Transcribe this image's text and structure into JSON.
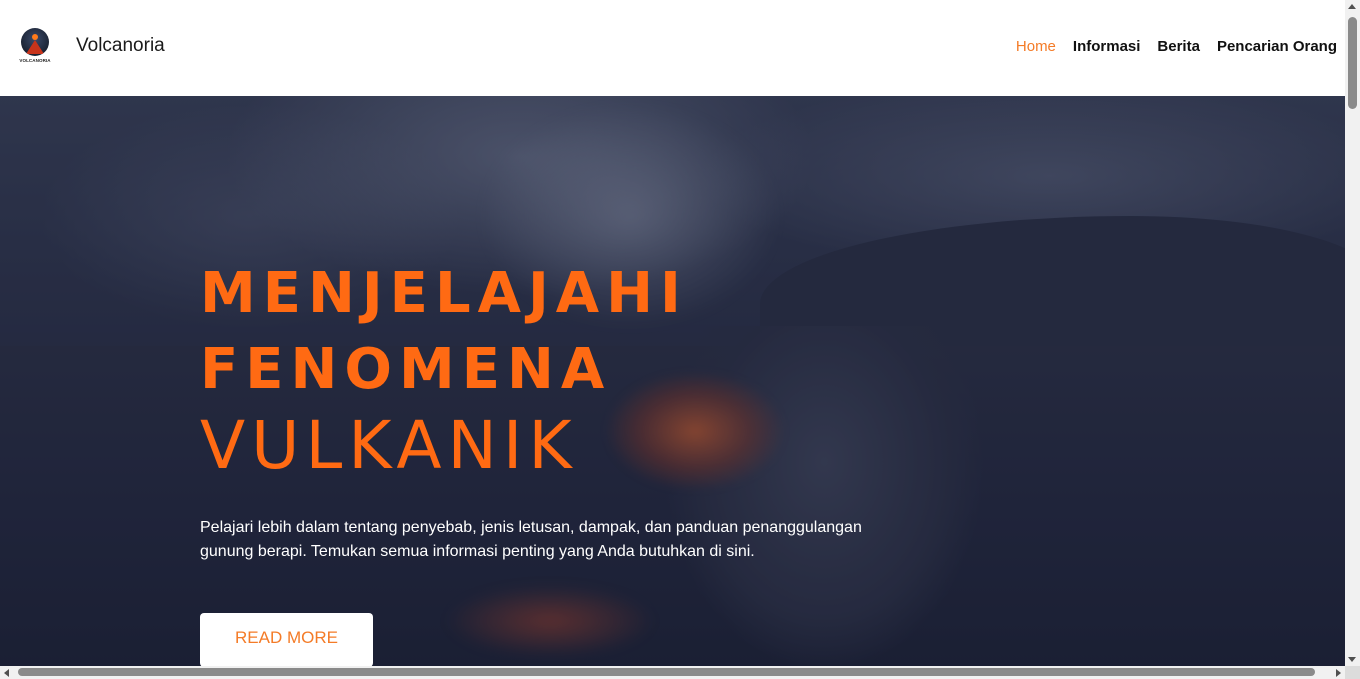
{
  "header": {
    "logo_icon": "volcano-logo-icon",
    "logo_caption": "VOLCANORIA",
    "brand": "Volcanoria",
    "nav": [
      {
        "label": "Home",
        "active": true
      },
      {
        "label": "Informasi",
        "active": false
      },
      {
        "label": "Berita",
        "active": false
      },
      {
        "label": "Pencarian Orang",
        "active": false
      }
    ]
  },
  "hero": {
    "title_line1": "MENJELAJAHI",
    "title_line2": "FENOMENA",
    "title_line3": "VULKANIK",
    "description": "Pelajari lebih dalam tentang penyebab, jenis letusan, dampak, dan panduan penanggulangan gunung berapi. Temukan semua informasi penting yang Anda butuhkan di sini.",
    "button_label": "READ MORE",
    "background": "erupting-volcano-photo"
  },
  "colors": {
    "accent": "#f47b27",
    "title": "#ff6a13",
    "overlay": "#19203c"
  }
}
